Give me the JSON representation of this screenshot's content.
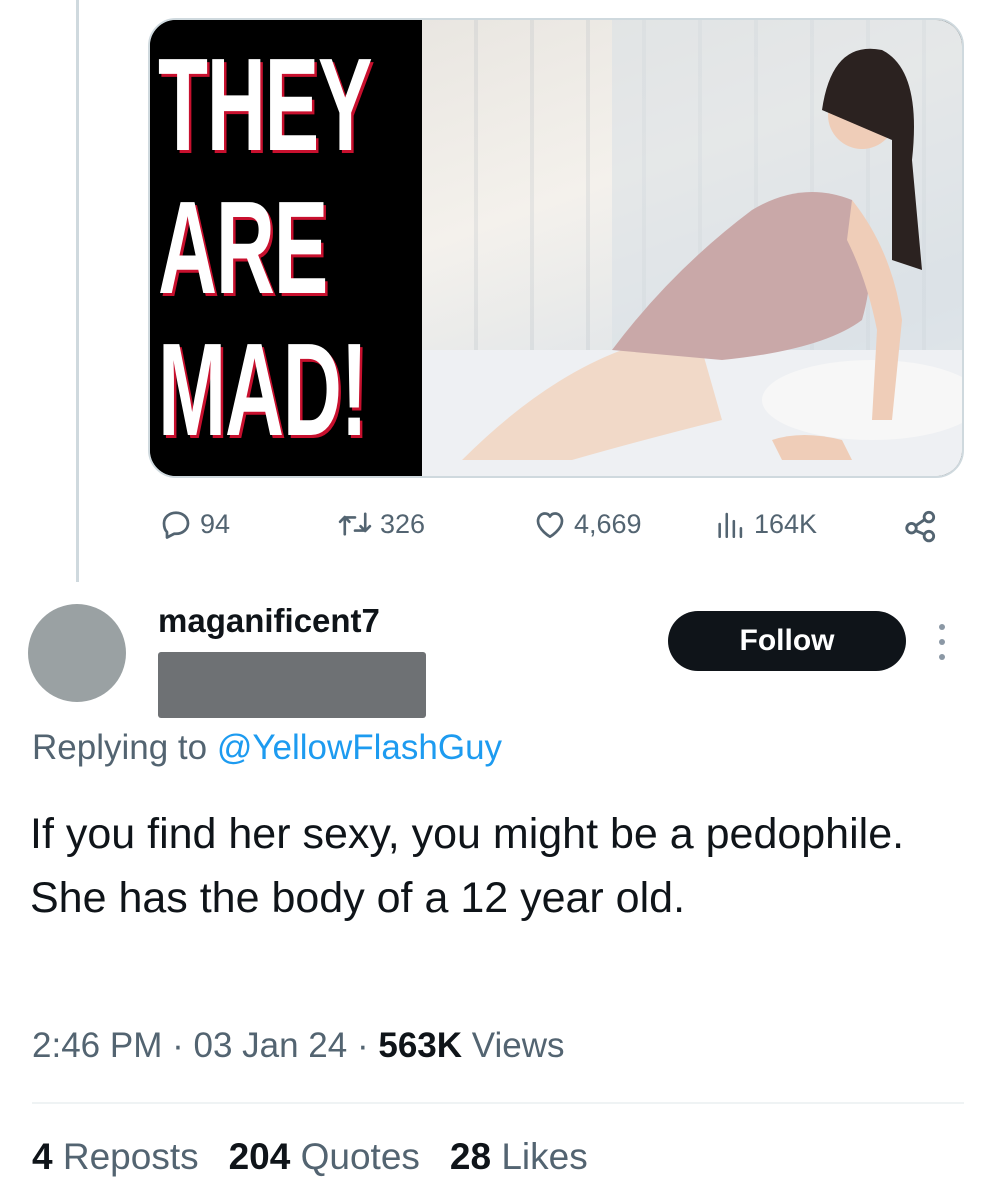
{
  "media": {
    "overlay_words": [
      "THEY",
      "ARE",
      "MAD!"
    ],
    "overlay_text_color": "#ffffff",
    "overlay_shadow_color": "#c8102e"
  },
  "parent_actions": {
    "replies": "94",
    "reposts": "326",
    "likes": "4,669",
    "views": "164K",
    "icons": [
      "reply-icon",
      "repost-icon",
      "like-icon",
      "views-icon",
      "share-icon"
    ]
  },
  "reply_tweet": {
    "author_name": "maganificent7",
    "follow_label": "Follow",
    "replying_prefix": "Replying to",
    "replying_mention": "@YellowFlashGuy",
    "text": "If you find her sexy, you might be a pedophile. She has the body of a 12 year old.",
    "time": "2:46 PM",
    "sep1": "·",
    "date": "03 Jan 24",
    "sep2": "·",
    "views_count": "563K",
    "views_label": "Views"
  },
  "stats": {
    "reposts_count": "4",
    "reposts_label": "Reposts",
    "quotes_count": "204",
    "quotes_label": "Quotes",
    "likes_count": "28",
    "likes_label": "Likes"
  },
  "colors": {
    "text_primary": "#0f1419",
    "text_secondary": "#536471",
    "link": "#1d9bf0",
    "follow_bg": "#0f1419"
  }
}
